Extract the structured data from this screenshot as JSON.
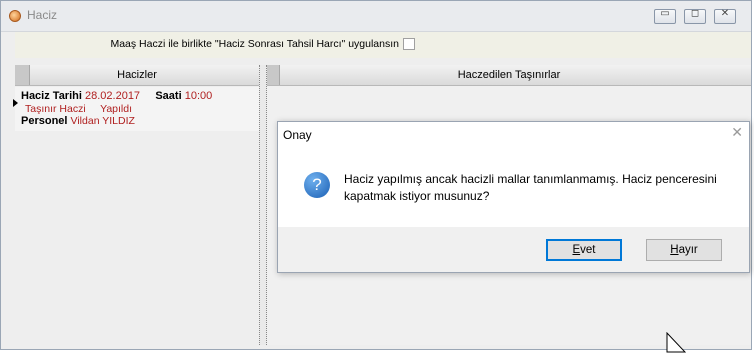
{
  "window": {
    "title": "Haciz",
    "controls": {
      "minimize": "▭",
      "maximize": "◻",
      "close": "✕"
    }
  },
  "options": {
    "label": "Maaş Haczi ile birlikte \"Haciz Sonrası Tahsil Harcı\" uygulansın",
    "checked": false
  },
  "left_panel": {
    "header": "Hacizler",
    "record": {
      "date_label": "Haciz Tarihi",
      "date_value": "28.02.2017",
      "time_label": "Saati",
      "time_value": "10:00",
      "type_value": "Taşınır Haczi",
      "status_value": "Yapıldı",
      "person_label": "Personel",
      "person_value": "Vildan YILDIZ"
    }
  },
  "right_panel": {
    "header": "Haczedilen Taşınırlar"
  },
  "dialog": {
    "title": "Onay",
    "icon": "question-icon",
    "message": "Haciz yapılmış ancak hacizli mallar tanımlanmamış. Haciz penceresini kapatmak istiyor musunuz?",
    "buttons": {
      "yes_mnemonic": "E",
      "yes_rest": "vet",
      "no_mnemonic": "H",
      "no_rest": "ayır"
    }
  },
  "colors": {
    "accent_red": "#b02020",
    "dialog_primary_border": "#0078d7"
  }
}
